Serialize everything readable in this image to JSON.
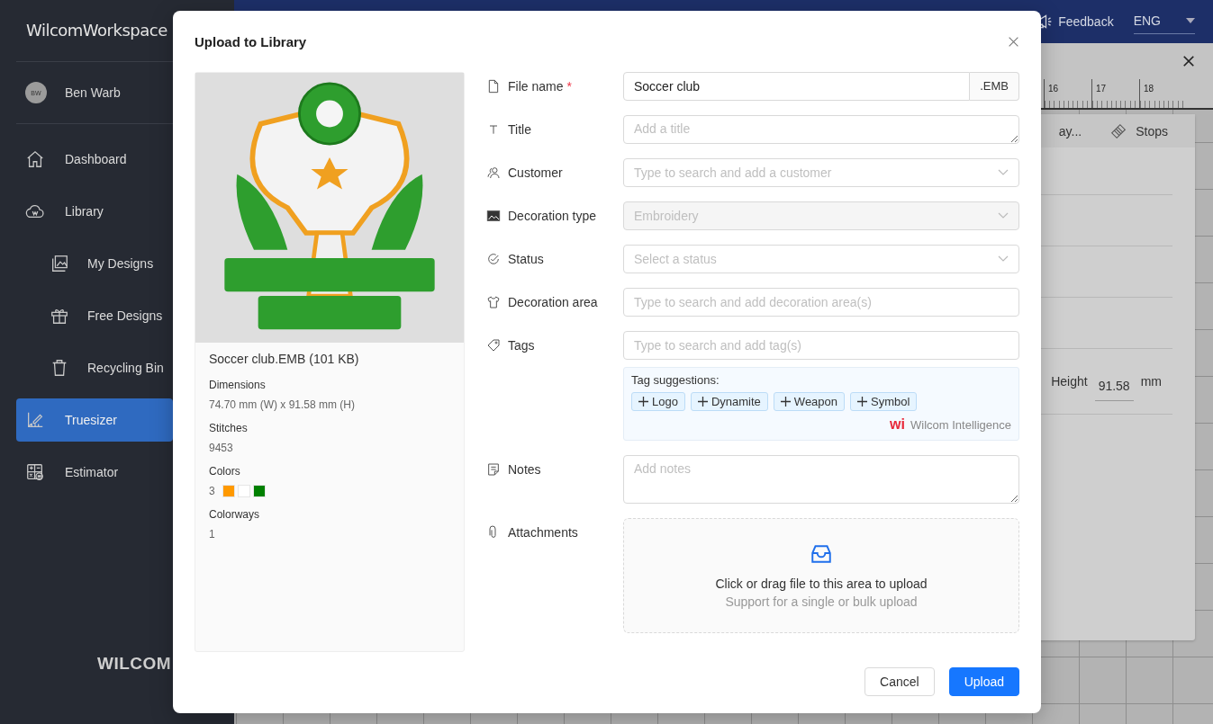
{
  "sidebar": {
    "brand": "WilcomWorkspace",
    "user": {
      "initials": "BW",
      "name": "Ben Warb"
    },
    "items": [
      {
        "label": "Dashboard",
        "selected": false
      },
      {
        "label": "Library",
        "selected": false,
        "children": [
          {
            "label": "My Designs",
            "selected": false
          },
          {
            "label": "Free Designs",
            "selected": false
          },
          {
            "label": "Recycling Bin",
            "selected": false
          }
        ]
      },
      {
        "label": "Truesizer",
        "selected": true
      },
      {
        "label": "Estimator",
        "selected": false
      }
    ],
    "logo": "WILCOM"
  },
  "top_bar": {
    "feedback": "Feedback",
    "language": "ENG"
  },
  "ruler": {
    "ticks": [
      "16",
      "17",
      "18"
    ]
  },
  "side_panel": {
    "tabs": [
      "ay...",
      "Stops"
    ],
    "height_label": "Height",
    "height_value": "91.58",
    "height_unit": "mm"
  },
  "dialog": {
    "title": "Upload to Library",
    "preview": {
      "file": "Soccer club.EMB (101 KB)",
      "details": [
        {
          "label": "Dimensions",
          "value": "74.70 mm (W) x 91.58 mm (H)"
        },
        {
          "label": "Stitches",
          "value": "9453"
        },
        {
          "label": "Colors",
          "value": "3",
          "swatches": [
            {
              "color": "#ff9900"
            },
            {
              "color": "#ffffff"
            },
            {
              "color": "#008000"
            }
          ]
        },
        {
          "label": "Colorways",
          "value": "1"
        }
      ]
    },
    "required_mark": "*",
    "fields": [
      {
        "kind": "text",
        "label": "File name",
        "required": true,
        "value": "Soccer club",
        "suffix": ".EMB"
      },
      {
        "kind": "textarea",
        "label": "Title",
        "placeholder": "Add a title"
      },
      {
        "kind": "select",
        "label": "Customer",
        "placeholder": "Type to search and add a customer"
      },
      {
        "kind": "select",
        "label": "Decoration type",
        "disabled": true,
        "value": "Embroidery"
      },
      {
        "kind": "select",
        "label": "Status",
        "placeholder": "Select a status"
      },
      {
        "kind": "text",
        "label": "Decoration area",
        "placeholder": "Type to search and add decoration area(s)"
      },
      {
        "kind": "text",
        "label": "Tags",
        "placeholder": "Type to search and add tag(s)",
        "suggestions": {
          "label": "Tag suggestions:",
          "tags": [
            "Logo",
            "Dynamite",
            "Weapon",
            "Symbol"
          ],
          "badge": "wi",
          "credit": "Wilcom Intelligence"
        }
      },
      {
        "kind": "notes",
        "label": "Notes",
        "placeholder": "Add notes"
      },
      {
        "kind": "upload",
        "label": "Attachments",
        "text": "Click or drag file to this area to upload",
        "hint": "Support for a single or bulk upload"
      }
    ],
    "buttons": [
      {
        "kind": "secondary",
        "label": "Cancel"
      },
      {
        "kind": "primary",
        "label": "Upload"
      }
    ]
  }
}
